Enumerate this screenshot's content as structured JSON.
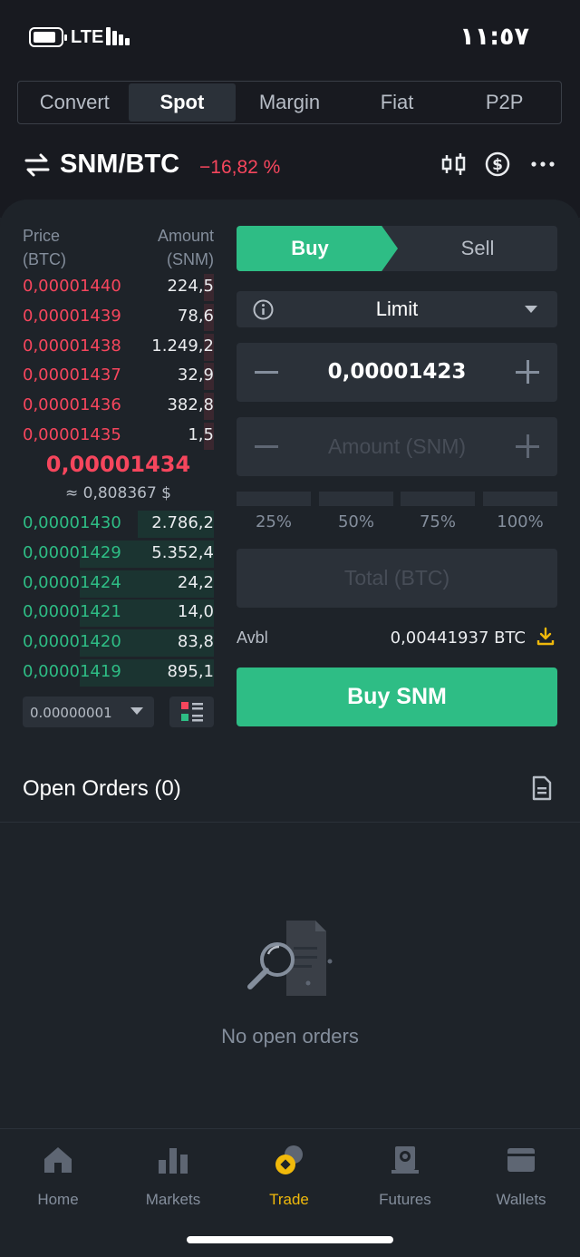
{
  "status_bar": {
    "network": "LTE",
    "time": "١١:٥٧"
  },
  "tabs": [
    {
      "label": "Convert"
    },
    {
      "label": "Spot"
    },
    {
      "label": "Margin"
    },
    {
      "label": "Fiat"
    },
    {
      "label": "P2P"
    }
  ],
  "active_tab": "Spot",
  "pair": {
    "symbol": "SNM/BTC",
    "change": "−16,82 %"
  },
  "order_book": {
    "price_header": "Price",
    "price_unit": "(BTC)",
    "amount_header": "Amount",
    "amount_unit": "(SNM)",
    "asks": [
      {
        "price": "0,00001440",
        "amount": "224,5",
        "depth": 0.05
      },
      {
        "price": "0,00001439",
        "amount": "78,6",
        "depth": 0.05
      },
      {
        "price": "0,00001438",
        "amount": "1.249,2",
        "depth": 0.05
      },
      {
        "price": "0,00001437",
        "amount": "32,9",
        "depth": 0.05
      },
      {
        "price": "0,00001436",
        "amount": "382,8",
        "depth": 0.05
      },
      {
        "price": "0,00001435",
        "amount": "1,5",
        "depth": 0.05
      }
    ],
    "last_price": "0,00001434",
    "last_price_fiat": "≈ 0,808367 $",
    "bids": [
      {
        "price": "0,00001430",
        "amount": "2.786,2",
        "depth": 0.4
      },
      {
        "price": "0,00001429",
        "amount": "5.352,4",
        "depth": 0.7
      },
      {
        "price": "0,00001424",
        "amount": "24,2",
        "depth": 0.7
      },
      {
        "price": "0,00001421",
        "amount": "14,0",
        "depth": 0.7
      },
      {
        "price": "0,00001420",
        "amount": "83,8",
        "depth": 0.7
      },
      {
        "price": "0,00001419",
        "amount": "895,1",
        "depth": 0.7
      }
    ],
    "precision": "0.00000001"
  },
  "trade_form": {
    "buy_label": "Buy",
    "sell_label": "Sell",
    "order_type": "Limit",
    "price_value": "0,00001423",
    "amount_placeholder": "Amount (SNM)",
    "percentages": [
      "25%",
      "50%",
      "75%",
      "100%"
    ],
    "total_placeholder": "Total (BTC)",
    "avbl_label": "Avbl",
    "avbl_value": "0,00441937 BTC",
    "submit_label": "Buy SNM"
  },
  "open_orders": {
    "title": "Open Orders (0)",
    "empty_text": "No open orders"
  },
  "bottom_nav": [
    {
      "label": "Home",
      "icon": "home-icon"
    },
    {
      "label": "Markets",
      "icon": "markets-icon"
    },
    {
      "label": "Trade",
      "icon": "trade-icon"
    },
    {
      "label": "Futures",
      "icon": "futures-icon"
    },
    {
      "label": "Wallets",
      "icon": "wallets-icon"
    }
  ],
  "colors": {
    "buy": "#2ebd85",
    "sell": "#f6465d",
    "accent": "#f0b90b",
    "background": "#1e2329"
  }
}
